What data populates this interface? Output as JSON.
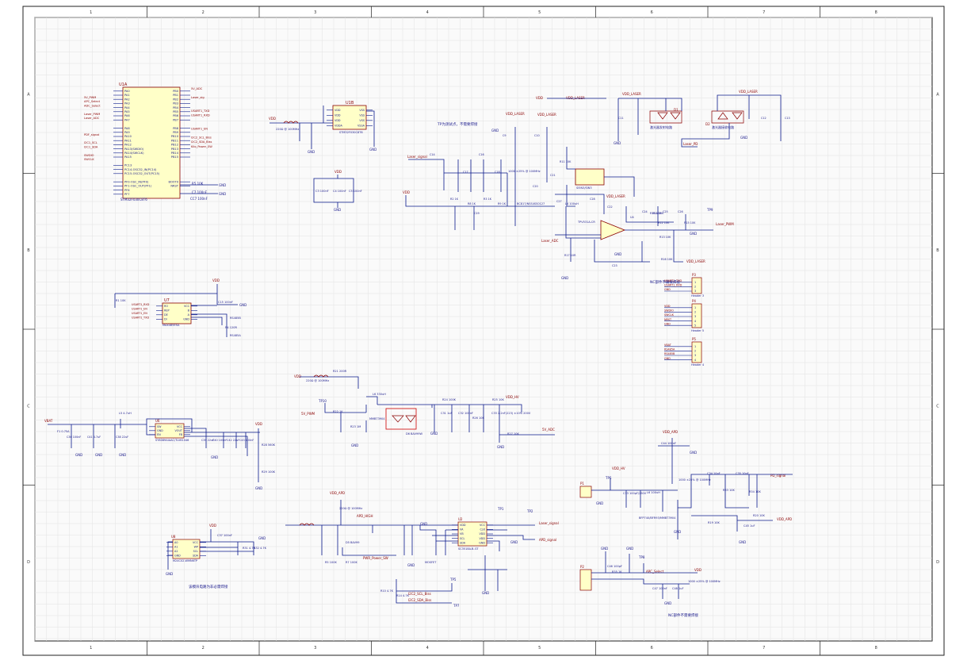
{
  "frame": {
    "cols": [
      "1",
      "2",
      "3",
      "4",
      "5",
      "6",
      "7",
      "8"
    ],
    "rows": [
      "A",
      "B",
      "C",
      "D"
    ]
  },
  "colors": {
    "wire": "#0b1a8c",
    "part": "#8a0000",
    "text": "#1a1a8c",
    "grid": "#e2e2e2",
    "frame": "#222222",
    "fill": "#ffffc8"
  },
  "mcu": {
    "ref": "U1A",
    "name": "STM32F030C8T6",
    "left_pins": [
      "PA0",
      "PA1",
      "PA2",
      "PA3",
      "PA4",
      "PA5",
      "PA6",
      "PA7",
      "",
      "PA8",
      "PA9",
      "PA10",
      "PA11",
      "PA12",
      "PA13(SWDIO)",
      "PA14(SWCLK)",
      "PA15",
      "",
      "PC13",
      "PC14-OSC32_IN(PC14)",
      "PC15-OSC32_OUT(PC15)",
      "",
      "PF0-OSC_IN(PF0)",
      "PF1-OSC_OUT(PF1)",
      "PF6",
      "PF7"
    ],
    "right_pins": [
      "PB0",
      "PB1",
      "PB2",
      "PB3",
      "PB4",
      "PB5",
      "PB6",
      "PB7",
      "",
      "PB8",
      "PB9",
      "PB10",
      "PB11",
      "PB12",
      "PB13",
      "PB14",
      "PB15",
      "",
      "",
      "",
      "",
      "",
      "BOOT0",
      "NRST"
    ],
    "left_nets": [
      "5V_PWM",
      "APC_Select",
      "ADC_Select",
      "",
      "Laser_PWM",
      "Laser_ADC",
      "",
      "",
      "",
      "PDF_signal",
      "",
      "I2C1_SCL",
      "I2C1_SDA",
      "",
      "SWDIO",
      "SWCLK"
    ],
    "right_nets": [
      "5V_ADC",
      "",
      "Laser_sig",
      "",
      "",
      "USART1_TXD",
      "USART1_RXD",
      "",
      "",
      "USART1_EN",
      "",
      "I2C2_SCL_Biss",
      "I2C2_SDA_Biss",
      "Kilo_Power_SW"
    ],
    "boot": "R5 10K",
    "nrst": "C7 100nF",
    "cc": "CC7 100nF"
  },
  "ldo": {
    "ref": "U1B",
    "name": "STM32F030C8T6",
    "pins_l": [
      "VDD",
      "VDD",
      "VDD",
      "VDDA"
    ],
    "pins_r": [
      "VSS",
      "VSS",
      "VSS",
      "VSSA"
    ],
    "vdd": "VDD",
    "bead": "220Ω @ 100MHz",
    "caps": [
      "C1",
      "C2"
    ]
  },
  "decoupling": {
    "vdd": "VDD",
    "caps": [
      "C3 100nF",
      "C4 100nF",
      "C5 100nF"
    ]
  },
  "rs485": {
    "ref": "U7",
    "name": "MAX485ESA",
    "pins_l": [
      "RO",
      "REP",
      "DE",
      "DI"
    ],
    "pins_r": [
      "VCC",
      "B",
      "A",
      "GND"
    ],
    "nets": [
      "USART1_RXD",
      "USART1_EN",
      "USART1_EN",
      "USART1_TXD"
    ],
    "r": "R1 10K",
    "c": "C15 100nF",
    "outs": [
      "RS485B",
      "RS485A"
    ],
    "rt": "R4 120R"
  },
  "laser_driver": {
    "note": "TP为测试点，不需要焊接",
    "vdd_laser": "VDD_LASER",
    "q_label": "BC817/NSS4SS0127",
    "u_label": "SI5N3/SIN3",
    "opa": "TPV531A-CR",
    "opa_label": "U4",
    "bead": "1000 ±25% @ 100MHz",
    "sig_net": "Laser_signal",
    "adc_net": "Laser_ADC",
    "pwm_net": "Laser_PWM",
    "pd_net": "Laser_PD",
    "diode1": "D1",
    "diode2": "D2",
    "d_note1": "激光器发射电路",
    "d_note2": "激光器接收电路",
    "r_labels": [
      "R2 1K",
      "R3 1K",
      "R8 1K",
      "R9 1K",
      "R11 10K",
      "R12 10K",
      "R13 10K",
      "R14 10K",
      "R15 10K",
      "R16 10K",
      "R17 10R",
      "R18 10R"
    ],
    "c_labels": [
      "C9",
      "C10",
      "C11",
      "C12",
      "C13",
      "C14",
      "C16",
      "C17",
      "C18",
      "C19",
      "C20",
      "C21",
      "C22",
      "C23",
      "C24",
      "C25",
      "C26",
      "C27",
      "C28"
    ],
    "l_label": "L4 100uH"
  },
  "connectors": {
    "note": "NC部件不需要焊接",
    "p3": {
      "ref": "P3",
      "nets": [
        "USART1_TXD",
        "USART1_RXD",
        "GND"
      ],
      "name": "Header 3"
    },
    "p4": {
      "ref": "P4",
      "nets": [
        "VDD",
        "SWDIO",
        "SWCLK",
        "NRST",
        "GND"
      ],
      "name": "Header 5"
    },
    "p5": {
      "ref": "P5",
      "nets": [
        "VBAT",
        "RS485A",
        "RS485B",
        "GND"
      ],
      "name": "Header 4"
    }
  },
  "boost": {
    "vdd": "VDD",
    "bead": "220Ω @ 100MHz",
    "tp": "TP10",
    "pwm_net": "5V_PWM",
    "q": "MMBT3904",
    "r_labels": [
      "R21 200R",
      "R22 1K",
      "R23 1M"
    ],
    "l": "L6 330uH",
    "d": "D6 BAV99W",
    "r_out": [
      "R24 100K",
      "R25 10K",
      "R26 10K",
      "R27 10K"
    ],
    "c_out": [
      "C31 1uF",
      "C32 100nF"
    ],
    "hv": "VDD_HV",
    "cap_hv": "C33 2.2nF(223) ±10% 200V",
    "adc_net": "5V_ADC"
  },
  "buck": {
    "vbat": "VBAT",
    "fuse": "F1 0.75A",
    "ref": "U6",
    "name": "SY8089AIAAC/TLV61046",
    "pins_l": [
      "SW",
      "GND",
      "EN"
    ],
    "pins_r": [
      "VCC",
      "VOUT",
      "FB"
    ],
    "l": "L5 4.7uH",
    "vdd": "VDD",
    "caps": [
      "C36 100nF",
      "C41 4.7uF",
      "C38 22uF",
      "C39 22uF",
      "C40 100nF",
      "C42 22uF",
      "C43 100nF"
    ],
    "rs": [
      "R28 560K",
      "R29 100K"
    ]
  },
  "eeprom": {
    "ref": "U8",
    "name": "M24C02-WMN6TP",
    "pins_l": [
      "A0",
      "A1",
      "A2",
      "GND"
    ],
    "pins_r": [
      "VCC",
      "WP",
      "SCL",
      "SDA"
    ],
    "vdd": "VDD",
    "rs": [
      "R31 4.7K",
      "R32 4.7K"
    ],
    "cap": "C37 100nF",
    "note": "该模块电路为非必需焊接"
  },
  "apd": {
    "vdd_apd": "VDD_APD",
    "bead": "220Ω @ 100MHz",
    "ref": "U2",
    "name": "SC3518A-B-GT",
    "pins_l": [
      "VDD",
      "VA",
      "VB",
      "SCL",
      "SDA"
    ],
    "pins_r": [
      "VCC",
      "CLK",
      "VDD",
      "VDD",
      "GND"
    ],
    "q": "MOSFET",
    "diode": "D5 BAV99",
    "apd_hv": "APD_HIGH",
    "nets": [
      "I2C2_SCL_Biss",
      "I2C2_SDA_Biss",
      "Laser_signal",
      "APD_signal"
    ],
    "power_sw": "PWR_Power_SW",
    "rs": [
      "R5 100K",
      "R7 100K",
      "R10 4.7K",
      "R14 4.7K"
    ],
    "tps": [
      "TP1",
      "TP2",
      "TP3",
      "TP4",
      "TP5",
      "TP6",
      "TP7"
    ]
  },
  "receiver": {
    "vdd_hv": "VDD_HV",
    "vdd_apd": "VDD_APD",
    "p1": "P1",
    "tp": "TP6",
    "c": "C33 100pF/250V",
    "l": "L6 100uH",
    "q": "BFP740/BFR93/MMBT3904",
    "out_net": "PD_signal",
    "bead": "1000 ±25% @ 100MHz",
    "rs": [
      "R19 10K",
      "R20 10K",
      "R33 10K",
      "R34 10K"
    ],
    "cs": [
      "C34 10pF",
      "C35 10pF",
      "C44 100nF",
      "C45 1uF"
    ]
  },
  "apc": {
    "p2": "P2",
    "net": "APC_Select",
    "vdd": "VDD",
    "bead": "1000 ±25% @ 100MHz",
    "tp": "TP8",
    "cs": [
      "C46 100pF",
      "C47 100nF",
      "C48 1uF"
    ],
    "r": "R35 1K",
    "note": "NC部件不需要焊接"
  }
}
